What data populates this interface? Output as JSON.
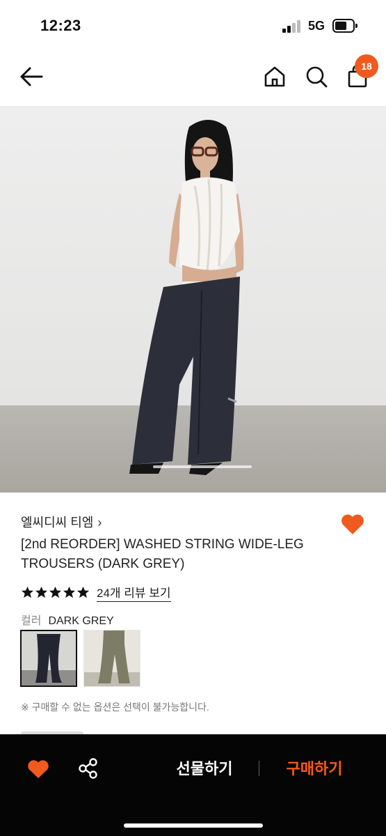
{
  "status_bar": {
    "time": "12:23",
    "network": "5G"
  },
  "nav": {
    "cart_count": "18"
  },
  "product": {
    "brand": "엘씨디씨 티엠",
    "brand_chevron": "›",
    "title": "[2nd REORDER] WASHED STRING WIDE-LEG TROUSERS (DARK GREY)",
    "rating_stars": 5,
    "review_link": "24개 리뷰 보기",
    "color_label": "컬러",
    "color_value": "DARK GREY",
    "notice": "※ 구매할 수 없는 옵션은 선택이 불가능합니다."
  },
  "bottom_bar": {
    "gift_label": "선물하기",
    "buy_label": "구매하기"
  },
  "colors": {
    "accent": "#f05a1e",
    "buy": "#ff5a14",
    "bottom_bg": "#050505"
  },
  "icons": [
    "arrow-left-icon",
    "home-icon",
    "search-icon",
    "shopping-bag-icon",
    "heart-icon",
    "star-icon",
    "share-icon"
  ]
}
